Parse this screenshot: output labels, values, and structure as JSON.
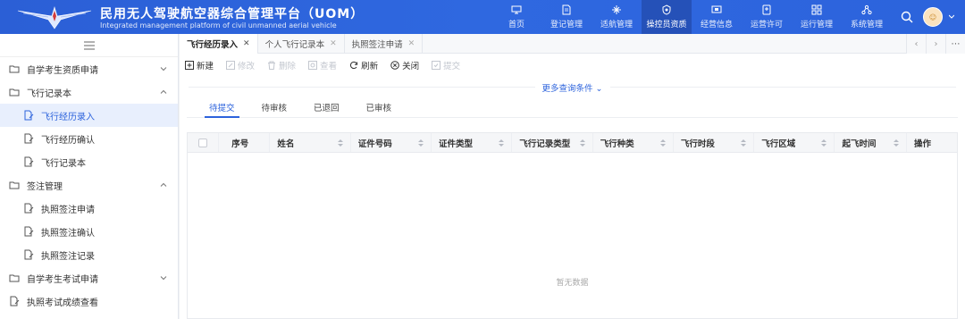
{
  "header": {
    "title": "民用无人驾驶航空器综合管理平台（UOM）",
    "subtitle": "Integrated management platform of civil unmanned aerial vehicle",
    "nav": [
      {
        "label": "首页",
        "icon": "monitor-icon"
      },
      {
        "label": "登记管理",
        "icon": "document-icon"
      },
      {
        "label": "适航管理",
        "icon": "plane-icon"
      },
      {
        "label": "操控员资质",
        "icon": "shield-icon",
        "active": true
      },
      {
        "label": "经营信息",
        "icon": "screen-icon"
      },
      {
        "label": "运营许可",
        "icon": "badge-icon"
      },
      {
        "label": "运行管理",
        "icon": "grid-icon"
      },
      {
        "label": "系统管理",
        "icon": "network-icon"
      }
    ],
    "accent": "#2c63dc"
  },
  "sidebar": {
    "items": [
      {
        "label": "自学考生资质申请",
        "type": "group",
        "caret": "down"
      },
      {
        "label": "飞行记录本",
        "type": "group",
        "caret": "up"
      },
      {
        "label": "飞行经历录入",
        "type": "sub",
        "active": true
      },
      {
        "label": "飞行经历确认",
        "type": "sub"
      },
      {
        "label": "飞行记录本",
        "type": "sub"
      },
      {
        "label": "签注管理",
        "type": "group",
        "caret": "up"
      },
      {
        "label": "执照签注申请",
        "type": "sub"
      },
      {
        "label": "执照签注确认",
        "type": "sub"
      },
      {
        "label": "执照签注记录",
        "type": "sub"
      },
      {
        "label": "自学考生考试申请",
        "type": "group",
        "caret": "down"
      },
      {
        "label": "执照考试成绩查看",
        "type": "group"
      }
    ]
  },
  "tabs": [
    {
      "label": "飞行经历录入",
      "active": true
    },
    {
      "label": "个人飞行记录本"
    },
    {
      "label": "执照签注申请"
    }
  ],
  "toolbar": {
    "buttons": [
      {
        "label": "新建",
        "enabled": true
      },
      {
        "label": "修改",
        "enabled": false
      },
      {
        "label": "删除",
        "enabled": false
      },
      {
        "label": "查看",
        "enabled": false
      },
      {
        "label": "刷新",
        "enabled": true
      },
      {
        "label": "关闭",
        "enabled": true
      },
      {
        "label": "提交",
        "enabled": false
      }
    ]
  },
  "more_filter_label": "更多查询条件",
  "subtabs": [
    {
      "label": "待提交",
      "active": true
    },
    {
      "label": "待审核"
    },
    {
      "label": "已退回"
    },
    {
      "label": "已审核"
    }
  ],
  "table": {
    "columns": [
      "序号",
      "姓名",
      "证件号码",
      "证件类型",
      "飞行记录类型",
      "飞行种类",
      "飞行时段",
      "飞行区域",
      "起飞时间",
      "操作"
    ],
    "empty_text": "暂无数据"
  }
}
